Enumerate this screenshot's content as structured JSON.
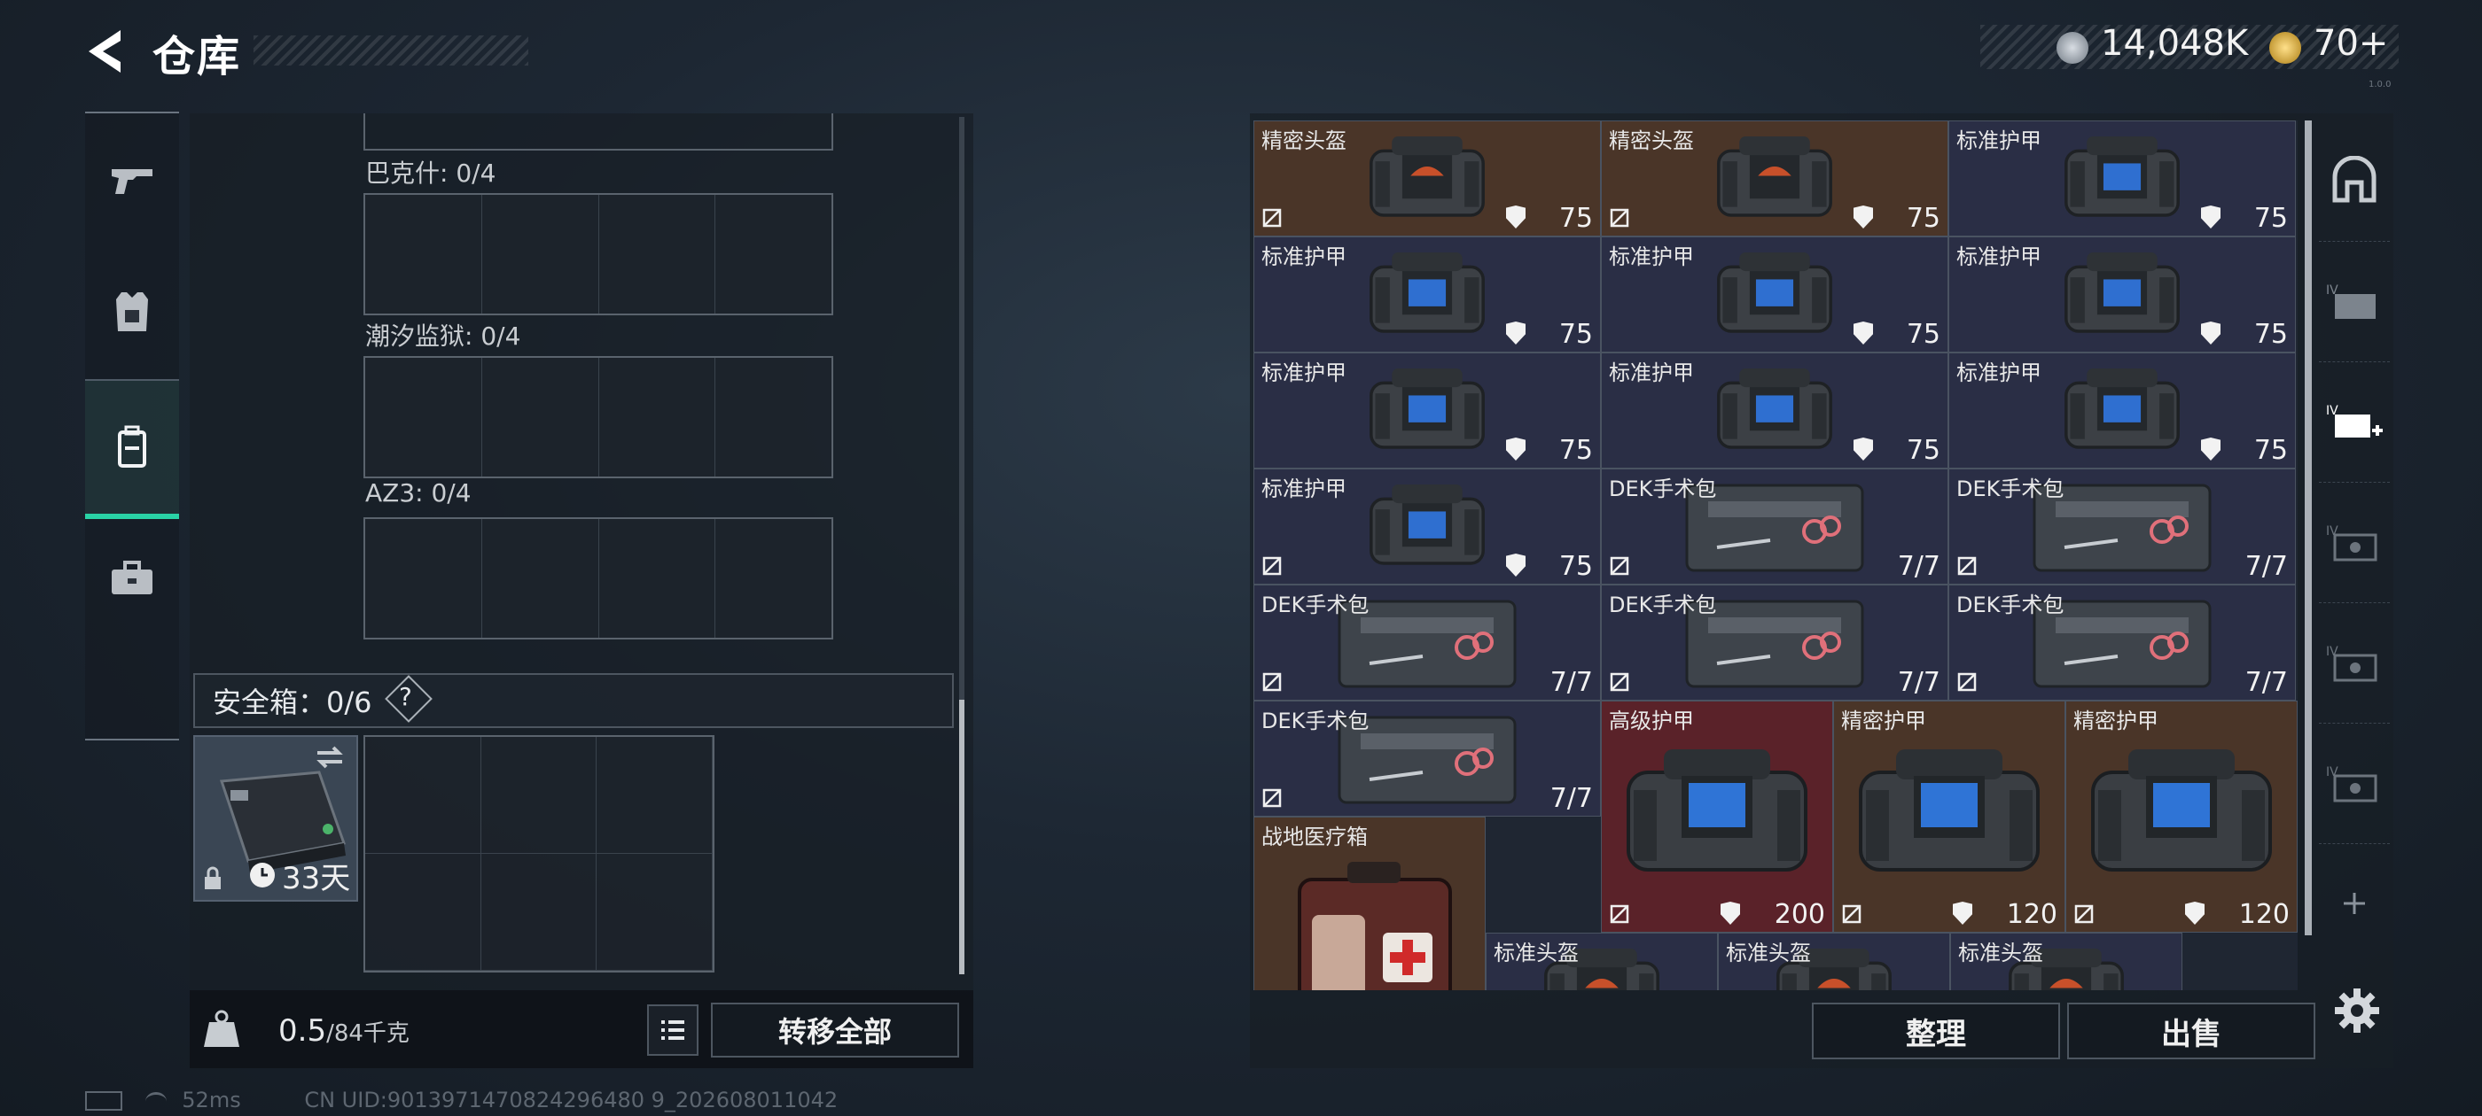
{
  "header": {
    "title": "仓库",
    "currency_1": "14,048K",
    "currency_2": "70+",
    "version": "1.0.0"
  },
  "nav": [
    {
      "id": "weapons",
      "icon": "gun-icon"
    },
    {
      "id": "armor",
      "icon": "vest-icon"
    },
    {
      "id": "backpack",
      "icon": "backpack-icon",
      "selected": true
    },
    {
      "id": "medkit",
      "icon": "toolbox-icon"
    }
  ],
  "left_panel": {
    "slots": [
      {
        "label": "巴克什: 0/4"
      },
      {
        "label": "潮汐监狱: 0/4"
      },
      {
        "label": "AZ3: 0/4"
      }
    ],
    "safe_box": {
      "label": "安全箱：0/6",
      "help": "?",
      "days": "33天"
    },
    "weight": {
      "current": "0.5",
      "max": "/84千克"
    },
    "transfer_all": "转移全部"
  },
  "status": {
    "ping": "52ms",
    "uid": "CN UID:9013971470824296480 9_202608011042"
  },
  "inventory": {
    "items": [
      {
        "name": "精密头盔",
        "value": "75",
        "color": "gold",
        "kind": "helmet"
      },
      {
        "name": "精密头盔",
        "value": "75",
        "color": "gold",
        "kind": "helmet"
      },
      {
        "name": "标准护甲",
        "value": "75",
        "color": "blue",
        "kind": "vest"
      },
      {
        "name": "标准护甲",
        "value": "75",
        "color": "blue",
        "kind": "vest"
      },
      {
        "name": "标准护甲",
        "value": "75",
        "color": "blue",
        "kind": "vest"
      },
      {
        "name": "标准护甲",
        "value": "75",
        "color": "blue",
        "kind": "vest"
      },
      {
        "name": "标准护甲",
        "value": "75",
        "color": "blue",
        "kind": "vest"
      },
      {
        "name": "标准护甲",
        "value": "75",
        "color": "blue",
        "kind": "vest"
      },
      {
        "name": "标准护甲",
        "value": "75",
        "color": "blue",
        "kind": "vest"
      },
      {
        "name": "标准护甲",
        "value": "75",
        "color": "blue",
        "kind": "vest"
      },
      {
        "name": "DEK手术包",
        "value": "7/7",
        "color": "blue",
        "kind": "kit"
      },
      {
        "name": "DEK手术包",
        "value": "7/7",
        "color": "blue",
        "kind": "kit"
      },
      {
        "name": "DEK手术包",
        "value": "7/7",
        "color": "blue",
        "kind": "kit"
      },
      {
        "name": "DEK手术包",
        "value": "7/7",
        "color": "blue",
        "kind": "kit"
      },
      {
        "name": "DEK手术包",
        "value": "7/7",
        "color": "blue",
        "kind": "kit"
      },
      {
        "name": "DEK手术包",
        "value": "7/7",
        "color": "blue",
        "kind": "kit"
      },
      {
        "name": "高级护甲",
        "value": "200",
        "color": "red",
        "kind": "bigvest"
      },
      {
        "name": "精密护甲",
        "value": "120",
        "color": "gold",
        "kind": "bigvest"
      },
      {
        "name": "精密护甲",
        "value": "120",
        "color": "gold",
        "kind": "bigvest"
      },
      {
        "name": "战地医疗箱",
        "value": "",
        "color": "gold",
        "kind": "medbox"
      },
      {
        "name": "标准头盔",
        "value": "",
        "color": "blue",
        "kind": "helmet"
      },
      {
        "name": "标准头盔",
        "value": "",
        "color": "blue",
        "kind": "helmet"
      },
      {
        "name": "标准头盔",
        "value": "",
        "color": "blue",
        "kind": "helmet"
      }
    ]
  },
  "actions": {
    "sort": "整理",
    "sell": "出售"
  },
  "side_tabs": [
    "armor-slot-icon",
    "case-iv-1-icon",
    "case-iv-add-icon",
    "case-iv-2-icon",
    "case-iv-3-icon",
    "case-iv-4-icon",
    "plus-icon"
  ]
}
